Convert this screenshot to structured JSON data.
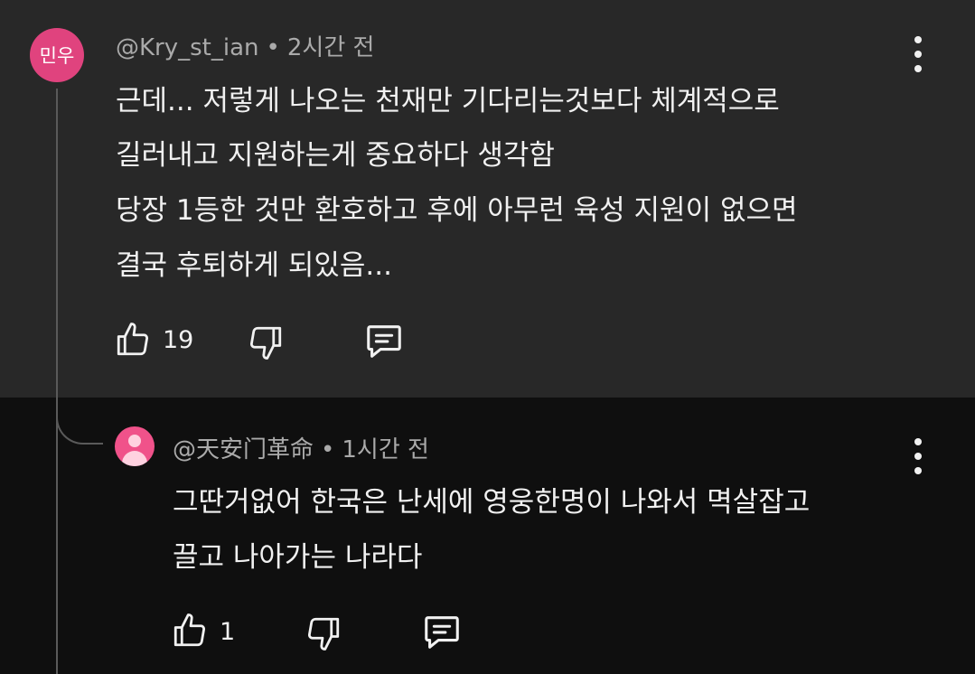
{
  "comment": {
    "avatar_text": "민우",
    "username": "@Kry_st_ian",
    "separator": "•",
    "time": "2시간 전",
    "lines": [
      "근데... 저렇게 나오는 천재만 기다리는것보다 체계적으로",
      "길러내고 지원하는게 중요하다 생각함",
      "당장 1등한 것만 환호하고 후에 아무런 육성 지원이 없으면",
      "결국 후퇴하게 되있음..."
    ],
    "like_count": "19",
    "icons": [
      "thumbs-up-icon",
      "thumbs-down-icon",
      "reply-icon",
      "more-vert-icon"
    ]
  },
  "reply": {
    "username": "@天安门革命",
    "separator": "•",
    "time": "1시간 전",
    "lines": [
      "그딴거없어 한국은 난세에 영웅한명이 나와서 멱살잡고",
      "끌고 나아가는 나라다"
    ],
    "like_count": "1",
    "icons": [
      "thumbs-up-icon",
      "thumbs-down-icon",
      "reply-icon",
      "more-vert-icon"
    ]
  },
  "colors": {
    "top_background": "#282828",
    "bottom_background": "#0f0f0f",
    "avatar_main": "#e0437e",
    "avatar_reply": "#f0528a",
    "text_primary": "#f1f1f1",
    "text_secondary": "#aaaaaa"
  }
}
